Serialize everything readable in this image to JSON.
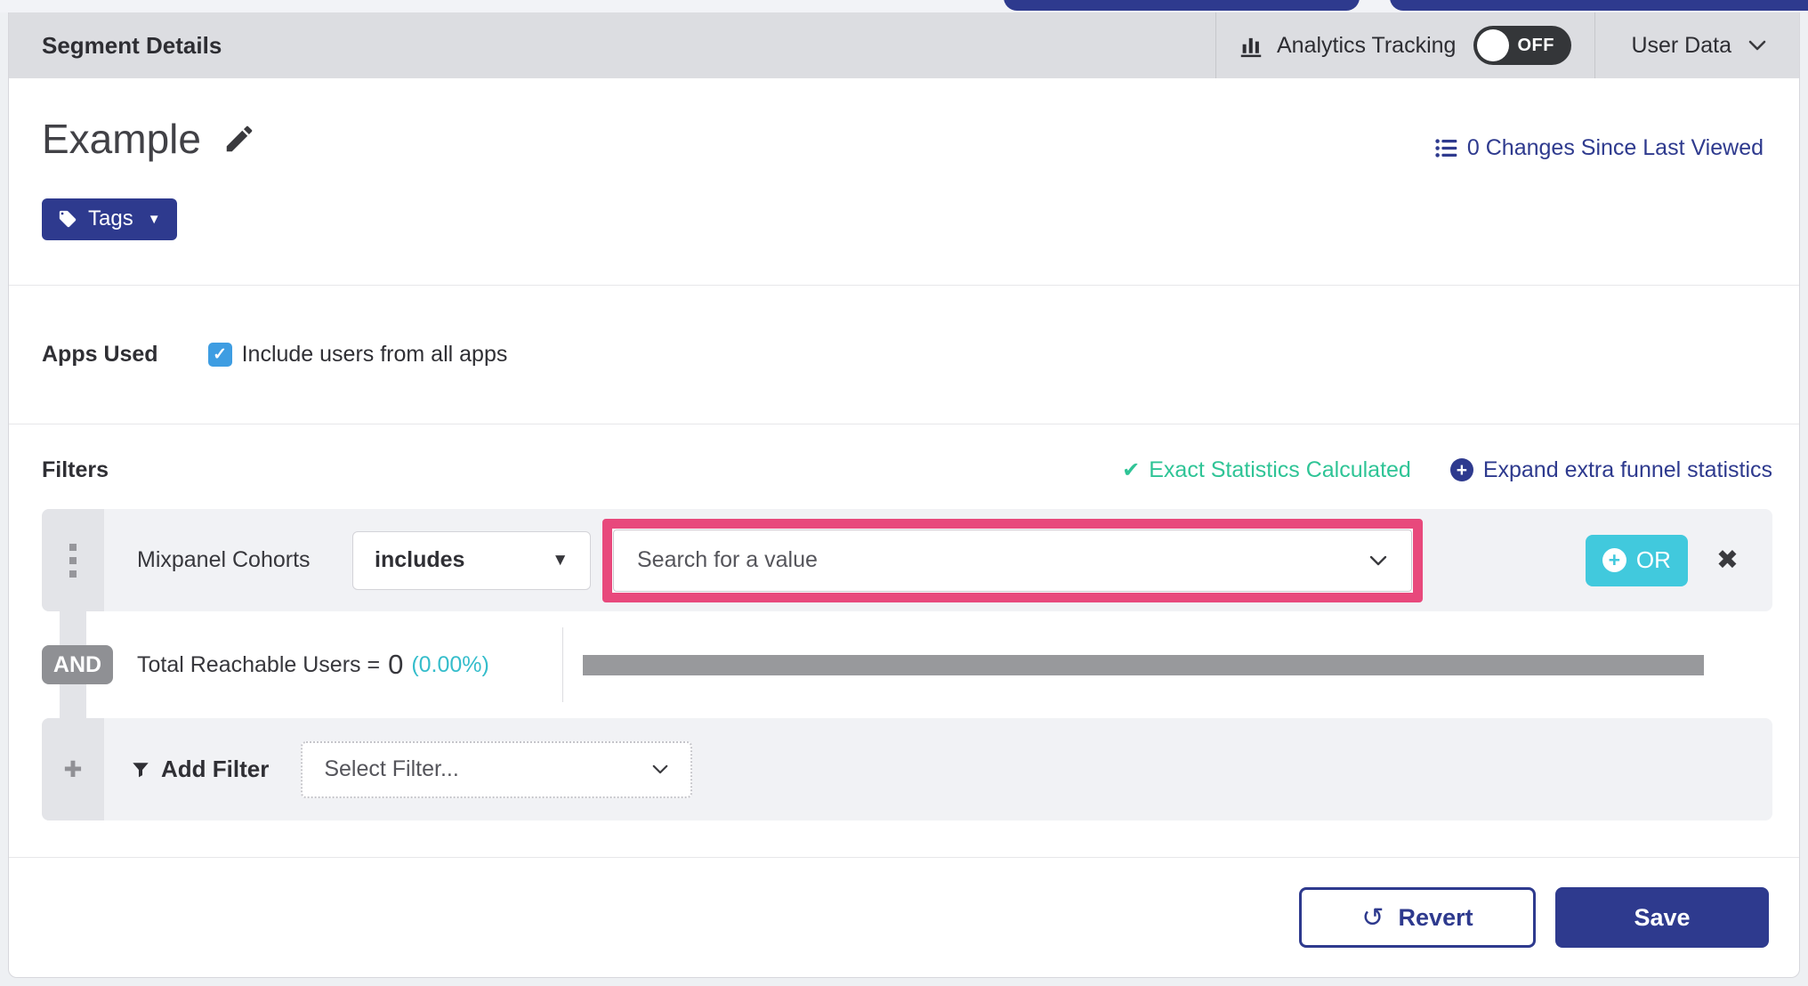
{
  "header": {
    "title": "Segment Details",
    "analytics_tracking_label": "Analytics Tracking",
    "toggle_state": "OFF",
    "user_data_label": "User Data"
  },
  "segment": {
    "name": "Example",
    "tags_button_label": "Tags",
    "changes_link": "0 Changes Since Last Viewed"
  },
  "apps_used": {
    "section_label": "Apps Used",
    "include_all_apps_label": "Include users from all apps",
    "checkbox_checked": true
  },
  "filters": {
    "section_label": "Filters",
    "exact_statistics_label": "Exact Statistics Calculated",
    "expand_funnel_label": "Expand extra funnel statistics",
    "row": {
      "field_name": "Mixpanel Cohorts",
      "operator_value": "includes",
      "value_placeholder": "Search for a value",
      "or_button_label": "OR"
    },
    "and_label": "AND",
    "total_reachable": {
      "label": "Total Reachable Users =",
      "count": "0",
      "percent": "(0.00%)"
    },
    "add_filter": {
      "label": "Add Filter",
      "select_placeholder": "Select Filter..."
    }
  },
  "footer": {
    "revert_label": "Revert",
    "save_label": "Save"
  },
  "icons": {
    "check": "✔",
    "checkbox_check": "✓",
    "close": "✖",
    "undo": "↺",
    "plus": "+",
    "caret_down": "▼",
    "gutter_plus": "✚"
  },
  "colors": {
    "accent_indigo": "#2e3a8e",
    "or_cyan": "#41c9dd",
    "stats_teal": "#2fc496",
    "highlight_pink": "#e8497c",
    "checkbox_blue": "#3e9de2",
    "header_gray": "#dcdde1"
  }
}
